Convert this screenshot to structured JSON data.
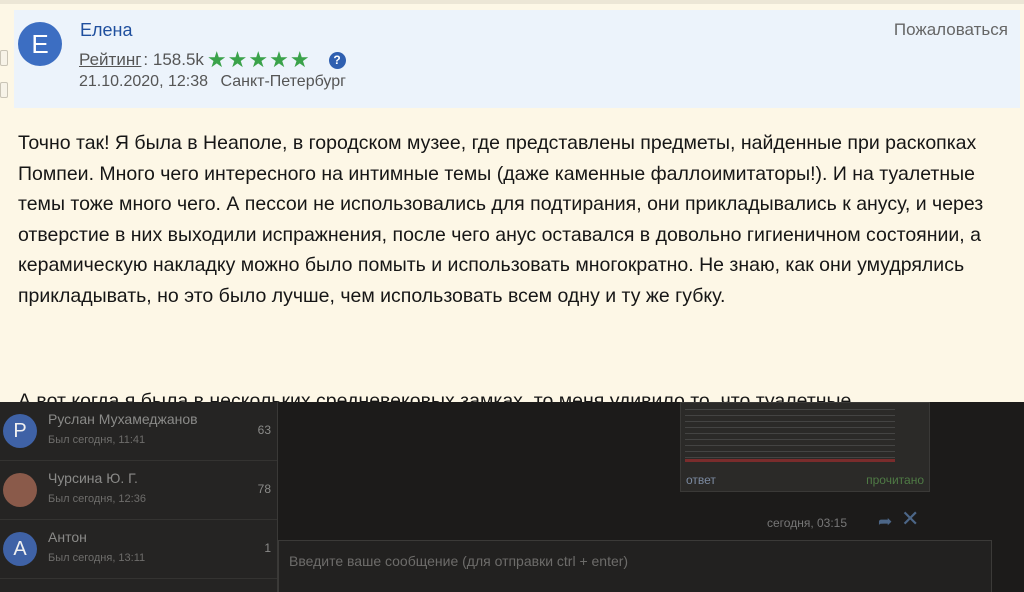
{
  "comment_header": {
    "avatar_letter": "Е",
    "author": "Елена",
    "report_label": "Пожаловаться",
    "rating_label": "Рейтинг",
    "rating_value": ": 158.5k",
    "stars": "★★★★★",
    "help_icon": "?",
    "date": "21.10.2020, 12:38",
    "location": "Санкт-Петербург"
  },
  "comment": {
    "text": "Точно так! Я была в Неаполе, в городском музее, где представлены предметы, найденные при раскопках Помпеи. Много чего интересного на интимные темы (даже каменные фаллоимитаторы!). И на туалетные темы тоже много чего. А пессои не использовались для подтирания, они прикладывались к анусу, и через отверстие в них выходили испражнения, после чего анус оставался в довольно гигиеничном состоянии, а керамическую накладку можно было помыть и использовать многократно. Не знаю, как они умудрялись прикладывать, но это было лучше, чем использовать всем одну и ту же губку.",
    "cut_line": "А вот когда я была в нескольких средневековых замках, то меня удивило то, что туалетные"
  },
  "chat_list": [
    {
      "avatar_letter": "Р",
      "name": "Руслан Мухамеджанов",
      "time": "Был сегодня, 11:41",
      "count": "63",
      "avatar_color": "#3f62a6"
    },
    {
      "avatar_letter": "",
      "name": "Чурсина Ю. Г.",
      "time": "Был сегодня, 12:36",
      "count": "78",
      "avatar_color": "#8a5a4a"
    },
    {
      "avatar_letter": "А",
      "name": "Антон",
      "time": "Был сегодня, 13:11",
      "count": "1",
      "avatar_color": "#3f62a6"
    }
  ],
  "message": {
    "reply_label": "ответ",
    "read_label": "прочитано",
    "time": "сегодня, 03:15"
  },
  "input": {
    "placeholder": "Введите ваше сообщение (для отправки ctrl + enter)"
  },
  "colors": {
    "page_background": "#fdf7e6",
    "header_background": "#ecf3fb",
    "link_blue": "#1f4f9e",
    "star_green": "#3aa24a",
    "overlay_dark": "#1c1b1a"
  }
}
